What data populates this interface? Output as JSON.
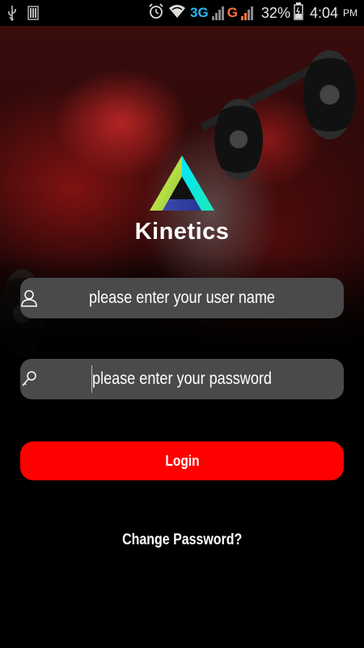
{
  "status_bar": {
    "network_3g": "3G",
    "network_g": "G",
    "battery_percent": "32%",
    "time": "4:04",
    "ampm": "PM",
    "icons": [
      "usb-icon",
      "sim-icon",
      "alarm-icon",
      "wifi-icon",
      "signal-icon",
      "battery-icon"
    ]
  },
  "brand": {
    "name": "Kinetics",
    "logo_colors": [
      "#c6ff3d",
      "#1de9b6",
      "#3f51b5"
    ]
  },
  "form": {
    "username_placeholder": "please enter your user name",
    "password_placeholder": "please enter your password",
    "login_label": "Login",
    "change_password_label": "Change Password?"
  },
  "colors": {
    "accent": "#ff0000",
    "field_bg": "#4a4a4a",
    "background": "#000000"
  }
}
